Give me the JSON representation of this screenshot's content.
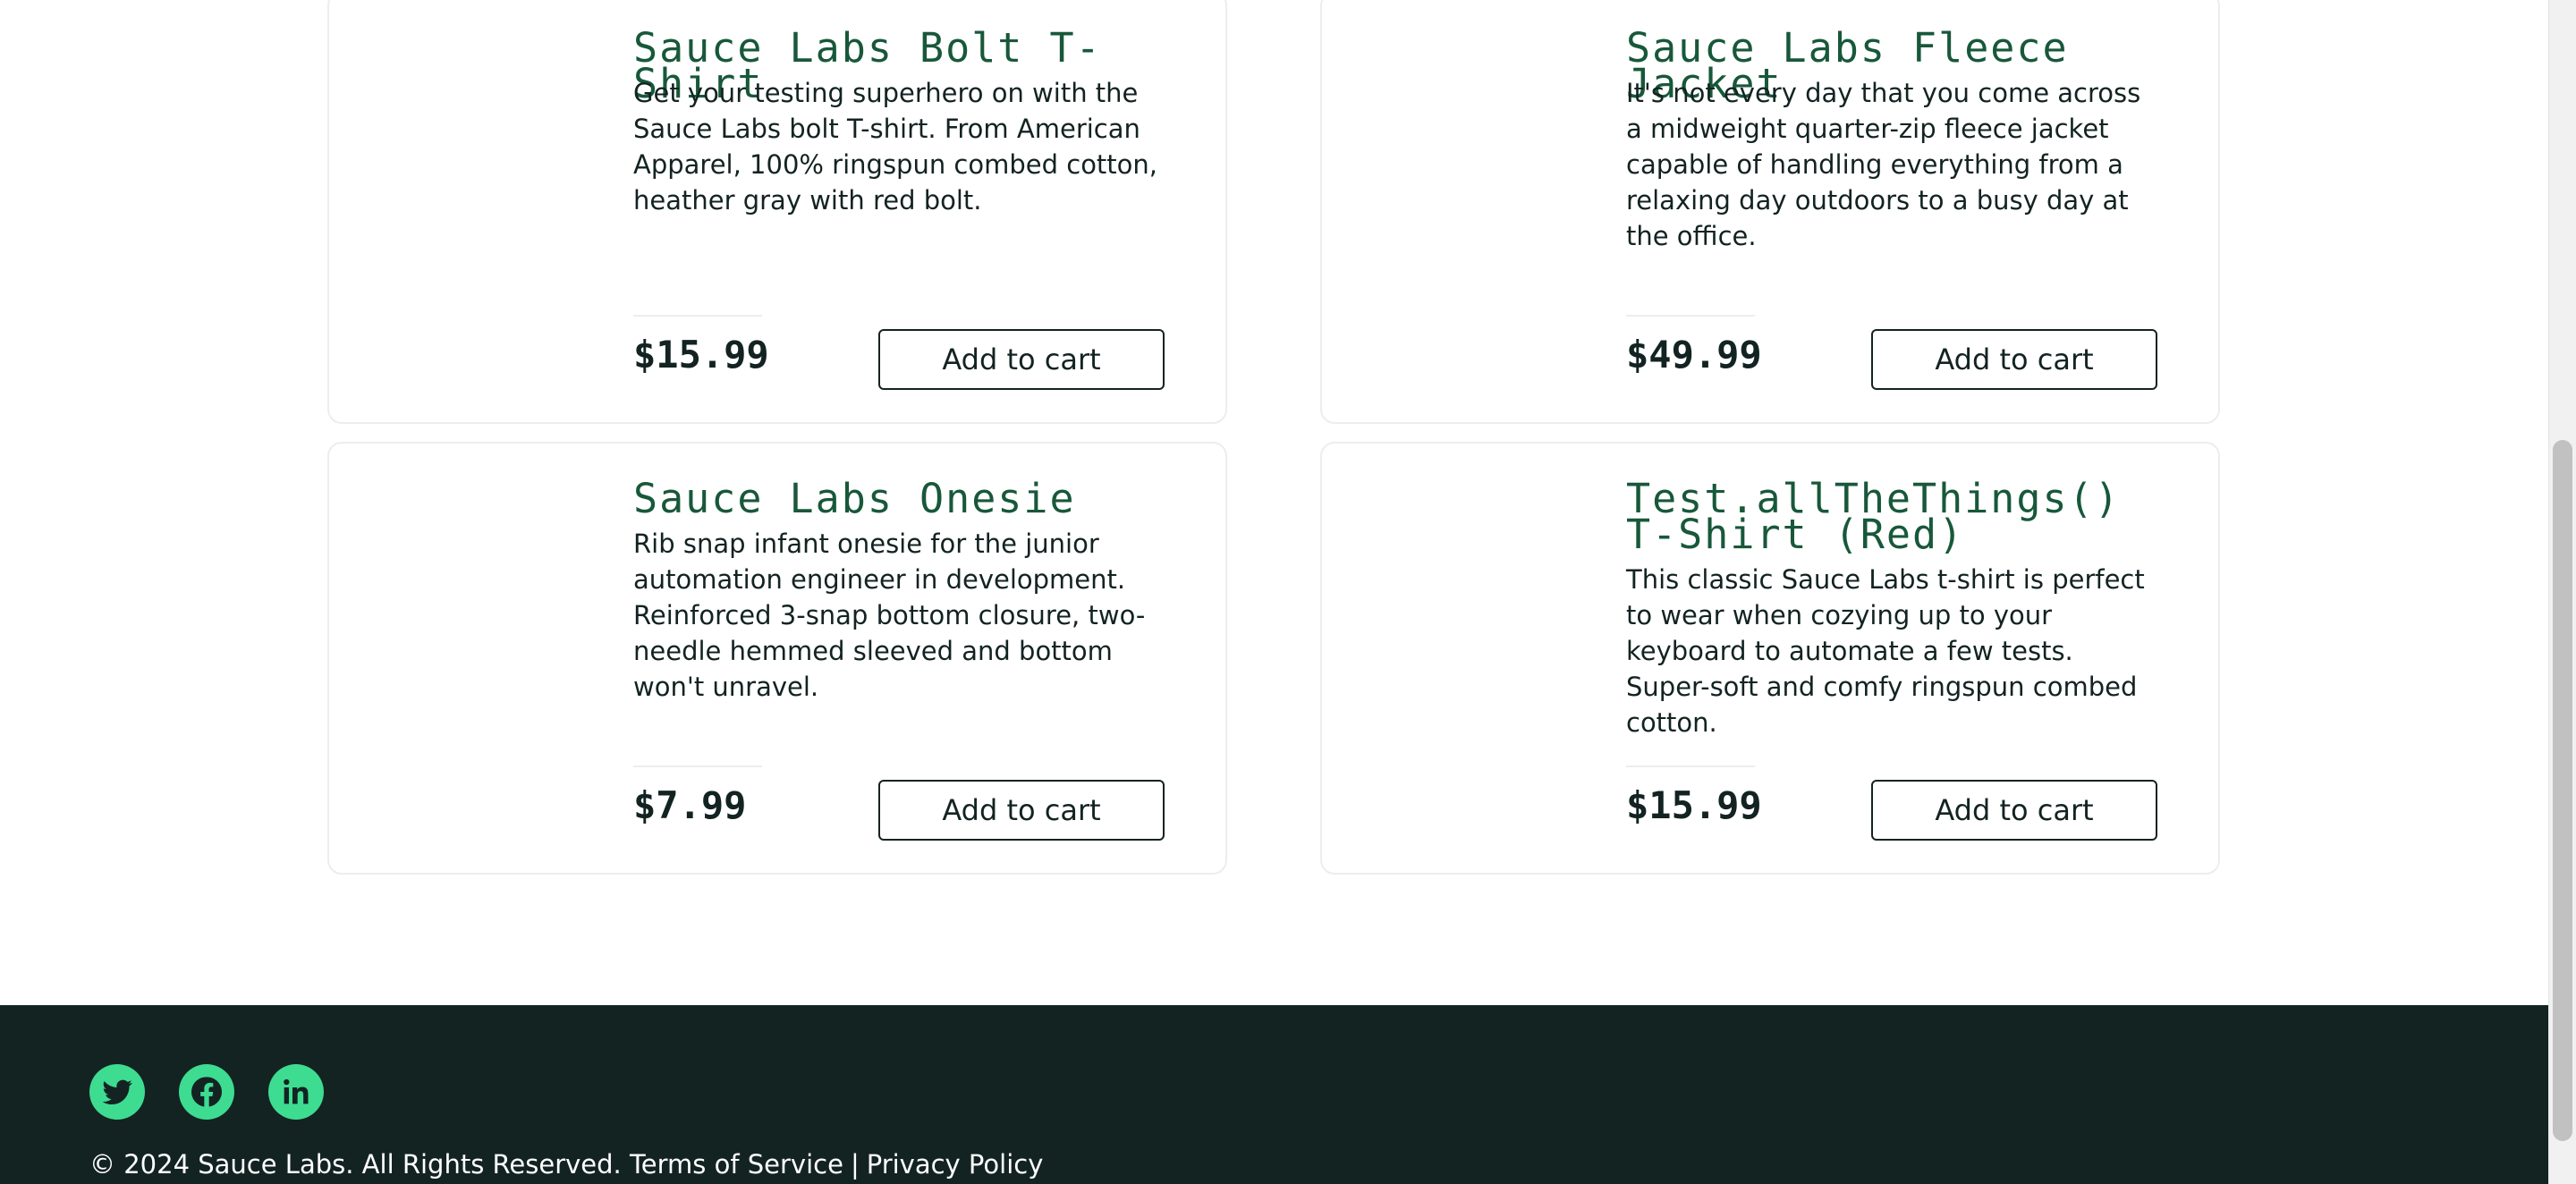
{
  "inventory": {
    "items": [
      {
        "name": "Sauce Labs Bolt T-Shirt",
        "description": "Get your testing superhero on with the Sauce Labs bolt T-shirt. From American Apparel, 100% ringspun combed cotton, heather gray with red bolt.",
        "price": "$15.99",
        "button_label": "Add to cart"
      },
      {
        "name": "Sauce Labs Fleece Jacket",
        "description": "It's not every day that you come across a midweight quarter-zip fleece jacket capable of handling everything from a relaxing day outdoors to a busy day at the office.",
        "price": "$49.99",
        "button_label": "Add to cart"
      },
      {
        "name": "Sauce Labs Onesie",
        "description": "Rib snap infant onesie for the junior automation engineer in development. Reinforced 3-snap bottom closure, two-needle hemmed sleeved and bottom won't unravel.",
        "price": "$7.99",
        "button_label": "Add to cart"
      },
      {
        "name": "Test.allTheThings() T-Shirt (Red)",
        "description": "This classic Sauce Labs t-shirt is perfect to wear when cozying up to your keyboard to automate a few tests. Super-soft and comfy ringspun combed cotton.",
        "price": "$15.99",
        "button_label": "Add to cart"
      }
    ]
  },
  "footer": {
    "social": [
      {
        "icon": "twitter-icon"
      },
      {
        "icon": "facebook-icon"
      },
      {
        "icon": "linkedin-icon"
      }
    ],
    "copy_text": "© 2024 Sauce Labs. All Rights Reserved.",
    "terms_label": "Terms of Service",
    "separator": "|",
    "privacy_label": "Privacy Policy"
  },
  "colors": {
    "title": "#18583a",
    "text": "#132322",
    "footer_bg": "#132322",
    "social_accent": "#3ddc91",
    "card_border": "#ededed"
  }
}
